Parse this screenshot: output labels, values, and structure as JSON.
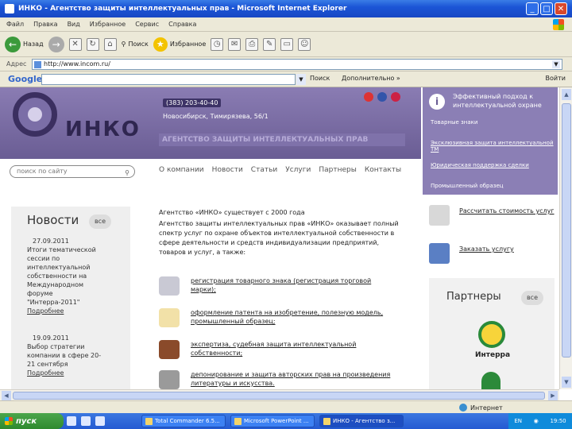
{
  "window": {
    "title": "ИНКО - Агентство защиты интеллектуальных прав - Microsoft Internet Explorer"
  },
  "menu": [
    "Файл",
    "Правка",
    "Вид",
    "Избранное",
    "Сервис",
    "Справка"
  ],
  "toolbar": {
    "back": "Назад",
    "search": "Поиск",
    "favorites": "Избранное"
  },
  "address": {
    "label": "Адрес",
    "url": "http://www.incom.ru/"
  },
  "google": {
    "logo": "Google",
    "search": "Поиск",
    "more": "Дополнительно »",
    "signin": "Войти"
  },
  "site": {
    "logo_text": "ИНКО",
    "phone": "(383) 203-40-40",
    "address": "Новосибирск, Тимирязева, 56/1",
    "tagline": "АГЕНТСТВО ЗАЩИТЫ ИНТЕЛЛЕКТУАЛЬНЫХ ПРАВ",
    "search_placeholder": "поиск по сайту",
    "nav": [
      "О компании",
      "Новости",
      "Статьи",
      "Услуги",
      "Партнеры",
      "Контакты"
    ]
  },
  "news": {
    "title": "Новости",
    "all": "все",
    "items": [
      {
        "date": "27.09.2011",
        "text": "Итоги тематической сессии по интеллектуальной собственности на Международном форуме \"Интерра-2011\"",
        "more": "Подробнее"
      },
      {
        "date": "19.09.2011",
        "text": "Выбор стратегии компании в сфере 20-21 сентября",
        "more": "Подробнее"
      }
    ]
  },
  "intro": {
    "p1": "Агентство «ИНКО» существует с 2000 года",
    "p2": "Агентство защиты интеллектуальных прав «ИНКО» оказывает полный спектр услуг по охране объектов интеллектуальной собственности в сфере деятельности и средств индивидуализации предприятий, товаров и услуг, а также:"
  },
  "services": [
    "регистрация товарного знака (регистрация торговой марки);",
    "оформление патента на изобретение, полезную модель, промышленный образец;",
    "экспертиза, судебная защита интеллектуальной собственности;",
    "депонирование и защита авторских прав на произведения литературы и искусства."
  ],
  "dropdown": {
    "head": "Эффективный подход к интеллектуальной охране",
    "links": [
      "Товарные знаки",
      "Эксклюзивная защита интеллектуальной ТМ",
      "Юридическая поддержка сделки",
      "Промышленный образец"
    ]
  },
  "right_services": [
    "Рассчитать стоимость услуг",
    "Заказать услугу"
  ],
  "partners": {
    "title": "Партнеры",
    "all": "все",
    "name": "Интерра"
  },
  "status": {
    "zone": "Интернет"
  },
  "taskbar": {
    "start": "пуск",
    "tasks": [
      "Total Commander 6.5...",
      "Microsoft PowerPoint ...",
      "ИНКО - Агентство з..."
    ],
    "lang": "EN",
    "clock": "19:50"
  }
}
